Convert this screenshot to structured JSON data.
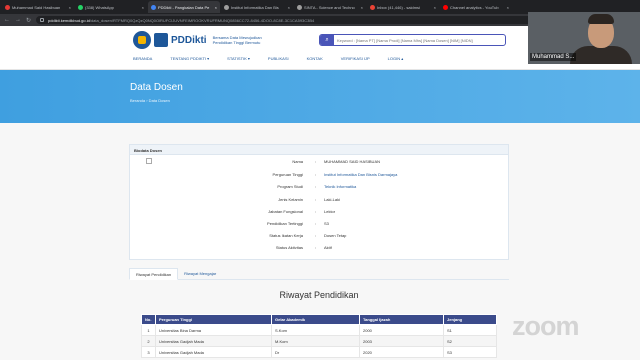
{
  "browser": {
    "tabs": [
      {
        "title": "Muhammad Said Hasibuan",
        "color": "#e53935",
        "active": false
      },
      {
        "title": "(338) WhatsApp",
        "color": "#25d366",
        "active": false
      },
      {
        "title": "PDDikti - Pangkalan Data Pe",
        "color": "#4285f4",
        "active": true
      },
      {
        "title": "Institut Informatika Dan Bis",
        "color": "#9e9e9e",
        "active": false
      },
      {
        "title": "SINTA - Science and Techno",
        "color": "#9e9e9e",
        "active": false
      },
      {
        "title": "Inbox (41,446) - saidmsi",
        "color": "#ea4335",
        "active": false
      },
      {
        "title": "Channel analytics - YouTub",
        "color": "#ff0000",
        "active": false
      }
    ],
    "url_host": "pddikti.kemdikbud.go.id",
    "url_path": "/data_dosen/RTFMRQ0QzQzQ0NQ0OlRUFCIJUVNFEIMROOKVRUFRMUNQ0856CC72-8456-4DOO-8C8E-3C1CA593C3B4"
  },
  "header": {
    "logo_text": "PDDikti",
    "logo_subtitle": "Bersama Data Mewujudkan Pendidikan Tinggi Bermutu",
    "search_placeholder": "Keyword : [Nama PT] [Nama Prodi] [Nama Mhs] [Nama Dosen] [NIM] [NIDN]",
    "menu": [
      "BERANDA",
      "TENTANG PDDIKTI ▾",
      "STATISTIK ▾",
      "PUBLIKASI",
      "KONTAK",
      "VERIFIKASI IJP",
      "LOGIN ▴"
    ]
  },
  "hero": {
    "title": "Data Dosen",
    "breadcrumb": "Beranda › Data Dosen"
  },
  "biodata": {
    "heading": "Biodata Dosen",
    "rows": [
      {
        "label": "Nama",
        "value": "MUHAMMAD SAID HASIBUAN",
        "link": false
      },
      {
        "label": "Perguruan Tinggi",
        "value": "Institut Informatika Dan Bisnis Darmajaya",
        "link": true
      },
      {
        "label": "Program Studi",
        "value": "Teknik Informatika",
        "link": true
      },
      {
        "label": "Jenis Kelamin",
        "value": "Laki-Laki",
        "link": false
      },
      {
        "label": "Jabatan Fungsional",
        "value": "Lektor",
        "link": false
      },
      {
        "label": "Pendidikan Tertinggi",
        "value": "S3",
        "link": false
      },
      {
        "label": "Status Ikatan Kerja",
        "value": "Dosen Tetap",
        "link": false
      },
      {
        "label": "Status Aktivitas",
        "value": "Aktif",
        "link": false
      }
    ]
  },
  "tabs": {
    "riwayat_pendidikan": "Riwayat Pendidikan",
    "riwayat_mengajar": "Riwayat Mengajar"
  },
  "section_title": "Riwayat Pendidikan",
  "table": {
    "headers": [
      "No.",
      "Perguruan Tinggi",
      "Gelar Akademik",
      "Tanggal Ijazah",
      "Jenjang"
    ],
    "rows": [
      [
        "1",
        "Universitas Bina Darma",
        "S.Kom",
        "2000",
        "S1"
      ],
      [
        "2",
        "Universitas Gadjah Mada",
        "M.Kom",
        "2003",
        "S2"
      ],
      [
        "3",
        "Universitas Gadjah Mada",
        "Dr",
        "2020",
        "S3"
      ]
    ]
  },
  "zoom": {
    "participant_name": "Muhammad S...",
    "watermark": "zoom"
  }
}
